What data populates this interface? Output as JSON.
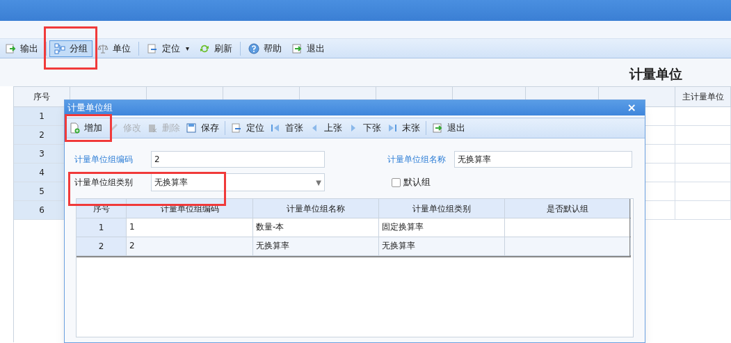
{
  "toolbar": [
    {
      "label": "输出",
      "selected": false
    },
    {
      "label": "分组",
      "selected": true
    },
    {
      "label": "单位",
      "selected": false
    },
    {
      "label": "定位",
      "selected": false,
      "caret": "▾"
    },
    {
      "label": "刷新",
      "selected": false
    },
    {
      "label": "帮助",
      "selected": false
    },
    {
      "label": "退出",
      "selected": false
    }
  ],
  "page_title": "计量单位",
  "main_table": {
    "columns": [
      "序号",
      "",
      "",
      "",
      "",
      "",
      "",
      "",
      "",
      "主计量单位"
    ],
    "rows": [
      "1",
      "2",
      "3",
      "4",
      "5",
      "6"
    ]
  },
  "dialog": {
    "title": "计量单位组",
    "close": "×",
    "toolbar": [
      {
        "label": "增加",
        "disabled": false
      },
      {
        "label": "修改",
        "disabled": true
      },
      {
        "label": "删除",
        "disabled": true
      },
      {
        "label": "保存",
        "disabled": false
      },
      {
        "label": "定位",
        "disabled": false
      },
      {
        "label": "首张",
        "disabled": false
      },
      {
        "label": "上张",
        "disabled": false
      },
      {
        "label": "下张",
        "disabled": false
      },
      {
        "label": "末张",
        "disabled": false
      },
      {
        "label": "退出",
        "disabled": false
      }
    ],
    "code_label": "计量单位组编码",
    "code_value": "2",
    "name_label": "计量单位组名称",
    "name_value": "无换算率",
    "type_label": "计量单位组类别",
    "type_value": "无换算率",
    "type_caret": "▼",
    "default_label": "默认组",
    "default_checked": false,
    "grid": {
      "columns": [
        "序号",
        "计量单位组编码",
        "计量单位组名称",
        "计量单位组类别",
        "是否默认组"
      ],
      "rows": [
        {
          "cells": [
            "1",
            "1",
            "数量-本",
            "固定换算率",
            ""
          ]
        },
        {
          "cells": [
            "2",
            "2",
            "无换算率",
            "无换算率",
            ""
          ]
        }
      ]
    }
  }
}
